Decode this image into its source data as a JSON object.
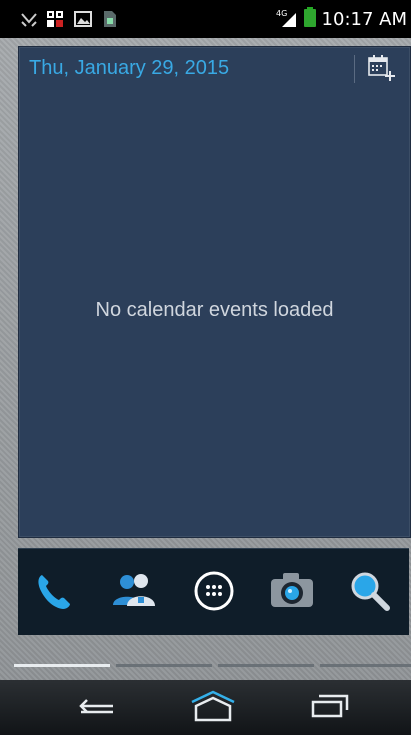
{
  "status_bar": {
    "time": "10:17 AM",
    "network": "4G",
    "icons": [
      "missed-call-icon",
      "qr-code-icon",
      "image-icon",
      "sim-icon",
      "signal-icon",
      "battery-icon"
    ]
  },
  "calendar_widget": {
    "date": "Thu, January 29, 2015",
    "empty_message": "No calendar events loaded",
    "add_icon": "calendar-add-icon"
  },
  "dock": {
    "items": [
      {
        "icon": "phone-icon"
      },
      {
        "icon": "contacts-icon"
      },
      {
        "icon": "app-drawer-icon"
      },
      {
        "icon": "camera-icon"
      },
      {
        "icon": "search-icon"
      }
    ]
  },
  "page_indicator": {
    "count": 4,
    "active_index": 0
  },
  "nav_bar": {
    "buttons": [
      "back-icon",
      "home-icon",
      "recent-apps-icon"
    ]
  },
  "colors": {
    "accent": "#39a9e4",
    "widget_bg": "#2c3f5a",
    "dock_bg": "#0f1d29"
  }
}
